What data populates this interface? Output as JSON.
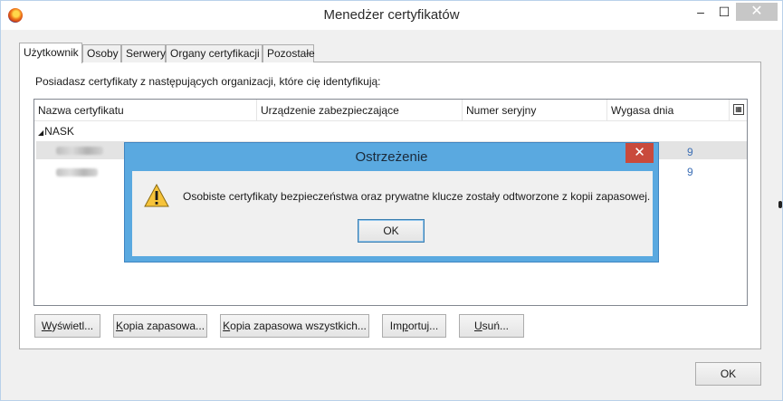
{
  "window": {
    "title": "Menedżer certyfikatów",
    "minimize_glyph": "–",
    "maximize_glyph": "☐",
    "close_glyph": "✕"
  },
  "tabs": [
    {
      "label": "Użytkownik",
      "active": true
    },
    {
      "label": "Osoby",
      "active": false
    },
    {
      "label": "Serwery",
      "active": false
    },
    {
      "label": "Organy certyfikacji",
      "active": false
    },
    {
      "label": "Pozostałe",
      "active": false
    }
  ],
  "panel": {
    "intro": "Posiadasz certyfikaty z następujących organizacji, które cię identyfikują:"
  },
  "tree": {
    "columns": [
      "Nazwa certyfikatu",
      "Urządzenie zabezpieczające",
      "Numer seryjny",
      "Wygasa dnia"
    ],
    "group": "NASK",
    "group_toggle_glyph": "◢",
    "column_picker_glyph": "▦",
    "partial_date_digit_1": "9",
    "partial_date_digit_2": "9"
  },
  "buttons": {
    "view": {
      "accel": "W",
      "rest": "yświetl..."
    },
    "backup": {
      "accel": "K",
      "rest": "opia zapasowa..."
    },
    "backup_all": {
      "accel": "K",
      "rest": "opia zapasowa wszystkich..."
    },
    "import": {
      "pre": "Im",
      "accel": "p",
      "rest": "ortuj..."
    },
    "delete": {
      "accel": "U",
      "rest": "suń..."
    },
    "ok": "OK"
  },
  "dialog": {
    "title": "Ostrzeżenie",
    "close_glyph": "✕",
    "message": "Osobiste certyfikaty bezpieczeństwa oraz prywatne klucze zostały odtworzone z kopii zapasowej.",
    "ok": "OK",
    "icon": "warning-icon"
  },
  "colors": {
    "dialog_frame": "#5aa9e0",
    "dialog_close": "#c94a3c",
    "selection_row": "#e3e3e3"
  }
}
